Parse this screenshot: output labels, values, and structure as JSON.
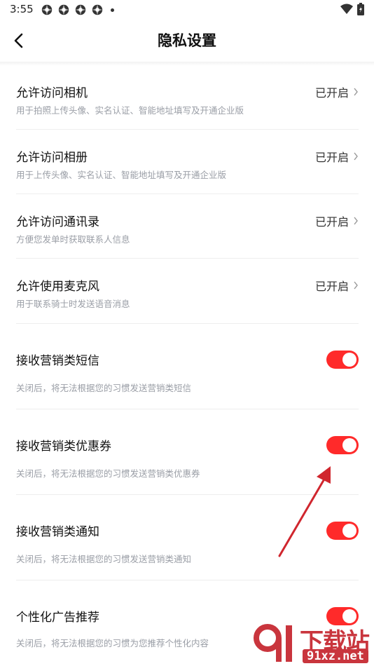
{
  "status_bar": {
    "time": "3:55",
    "notification_icons": [
      "app-icon",
      "app-icon",
      "app-icon",
      "app-icon"
    ],
    "right_icons": [
      "wifi-icon",
      "battery-icon"
    ]
  },
  "nav": {
    "title": "隐私设置",
    "back_icon": "chevron-left-icon"
  },
  "permissions": [
    {
      "label": "允许访问相机",
      "desc": "用于拍照上传头像、实名认证、智能地址填写及开通企业版",
      "status": "已开启"
    },
    {
      "label": "允许访问相册",
      "desc": "用于上传头像、实名认证、智能地址填写及开通企业版",
      "status": "已开启"
    },
    {
      "label": "允许访问通讯录",
      "desc": "方便您发单时获取联系人信息",
      "status": "已开启"
    },
    {
      "label": "允许使用麦克风",
      "desc": "用于联系骑士时发送语音消息",
      "status": "已开启"
    }
  ],
  "toggles": [
    {
      "label": "接收营销类短信",
      "desc": "关闭后，将无法根据您的习惯发送营销类短信",
      "on": true
    },
    {
      "label": "接收营销类优惠券",
      "desc": "关闭后，将无法根据您的习惯发送营销类优惠券",
      "on": true
    },
    {
      "label": "接收营销类通知",
      "desc": "关闭后，将无法根据您的习惯发送营销类通知",
      "on": true
    },
    {
      "label": "个性化广告推荐",
      "desc": "关闭后，将无法根据您的习惯为您推荐个性化内容",
      "on": true
    }
  ],
  "colors": {
    "toggle_on": "#ff2a2a",
    "annotation_arrow": "#d0262e",
    "watermark": "#c9353d"
  },
  "watermark": {
    "brand": "下载站",
    "url": "91xz.net"
  }
}
